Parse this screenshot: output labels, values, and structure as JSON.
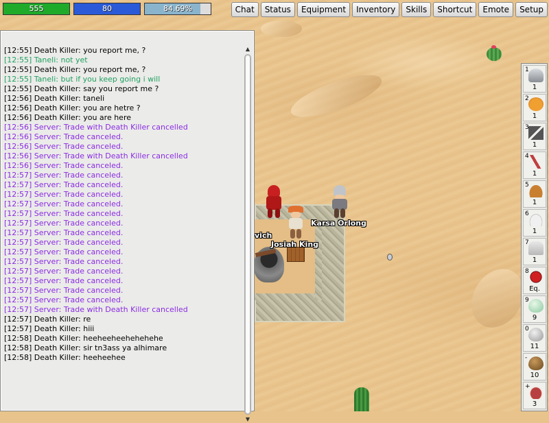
{
  "stats": {
    "hp": {
      "value": "555",
      "fraction": 1.0,
      "color": "#1faa2a"
    },
    "mp": {
      "value": "80",
      "fraction": 1.0,
      "color": "#2a5ad8"
    },
    "xp": {
      "value": "84.69%",
      "fraction": 0.8469,
      "color": "#8ab4cc"
    }
  },
  "menu": [
    "Chat",
    "Status",
    "Equipment",
    "Inventory",
    "Skills",
    "Shortcut",
    "Emote",
    "Setup"
  ],
  "chat": {
    "lines": [
      {
        "text": "[12:55] Death Killer: you report me, ?",
        "kind": "player"
      },
      {
        "text": "[12:55] Taneli: not yet",
        "kind": "whisper"
      },
      {
        "text": "[12:55] Death Killer: you report me, ?",
        "kind": "player"
      },
      {
        "text": "[12:55] Taneli: but if you keep going i will",
        "kind": "whisper"
      },
      {
        "text": "[12:55] Death Killer: say you report me ?",
        "kind": "player"
      },
      {
        "text": "[12:56] Death Killer: taneli",
        "kind": "player"
      },
      {
        "text": "[12:56] Death Killer: you are hetre ?",
        "kind": "player"
      },
      {
        "text": "[12:56] Death Killer: you are here",
        "kind": "player"
      },
      {
        "text": "[12:56] Server: Trade with Death Killer cancelled",
        "kind": "server"
      },
      {
        "text": "[12:56] Server: Trade canceled.",
        "kind": "server"
      },
      {
        "text": "[12:56] Server: Trade canceled.",
        "kind": "server"
      },
      {
        "text": "[12:56] Server: Trade with Death Killer cancelled",
        "kind": "server"
      },
      {
        "text": "[12:56] Server: Trade canceled.",
        "kind": "server"
      },
      {
        "text": "[12:57] Server: Trade canceled.",
        "kind": "server"
      },
      {
        "text": "[12:57] Server: Trade canceled.",
        "kind": "server"
      },
      {
        "text": "[12:57] Server: Trade canceled.",
        "kind": "server"
      },
      {
        "text": "[12:57] Server: Trade canceled.",
        "kind": "server"
      },
      {
        "text": "[12:57] Server: Trade canceled.",
        "kind": "server"
      },
      {
        "text": "[12:57] Server: Trade canceled.",
        "kind": "server"
      },
      {
        "text": "[12:57] Server: Trade canceled.",
        "kind": "server"
      },
      {
        "text": "[12:57] Server: Trade canceled.",
        "kind": "server"
      },
      {
        "text": "[12:57] Server: Trade canceled.",
        "kind": "server"
      },
      {
        "text": "[12:57] Server: Trade canceled.",
        "kind": "server"
      },
      {
        "text": "[12:57] Server: Trade canceled.",
        "kind": "server"
      },
      {
        "text": "[12:57] Server: Trade canceled.",
        "kind": "server"
      },
      {
        "text": "[12:57] Server: Trade canceled.",
        "kind": "server"
      },
      {
        "text": "[12:57] Server: Trade canceled.",
        "kind": "server"
      },
      {
        "text": "[12:57] Server: Trade with Death Killer cancelled",
        "kind": "server"
      },
      {
        "text": "[12:57] Death Killer: re",
        "kind": "player"
      },
      {
        "text": "[12:57] Death Killer: hiii",
        "kind": "player"
      },
      {
        "text": "[12:58] Death Killer: heeheeheehehehehe",
        "kind": "player"
      },
      {
        "text": "[12:58] Death Killer: sir tn3ass ya alhimare",
        "kind": "player"
      },
      {
        "text": "[12:58] Death Killer: heeheehee",
        "kind": "player"
      }
    ]
  },
  "players": [
    {
      "name": "Karsa Orlong"
    },
    {
      "name": "Josiah King"
    },
    {
      "name": "vich"
    }
  ],
  "shortcuts": [
    {
      "key": "1",
      "count": "1",
      "icon": "helmet-icon"
    },
    {
      "key": "2",
      "count": "1",
      "icon": "pumpkin-icon"
    },
    {
      "key": "3",
      "count": "1",
      "icon": "bat-wings-icon"
    },
    {
      "key": "4",
      "count": "1",
      "icon": "feather-icon"
    },
    {
      "key": "5",
      "count": "1",
      "icon": "hat-icon"
    },
    {
      "key": "6",
      "count": "1",
      "icon": "cap-icon"
    },
    {
      "key": "7",
      "count": "1",
      "icon": "cloak-icon"
    },
    {
      "key": "8",
      "count": "Eq.",
      "icon": "demon-mask-icon"
    },
    {
      "key": "9",
      "count": "9",
      "icon": "green-egg-icon"
    },
    {
      "key": "0",
      "count": "11",
      "icon": "grey-egg-icon"
    },
    {
      "key": "-",
      "count": "10",
      "icon": "brown-egg-icon"
    },
    {
      "key": "+",
      "count": "3",
      "icon": "meat-icon"
    }
  ]
}
